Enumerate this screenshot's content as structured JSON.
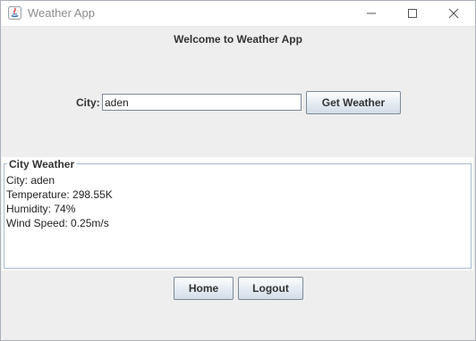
{
  "window": {
    "title": "Weather App",
    "icon": "java-icon",
    "controls": {
      "minimize_icon": "minimize-icon",
      "maximize_icon": "maximize-icon",
      "close_icon": "close-icon"
    }
  },
  "header": {
    "welcome": "Welcome to Weather App"
  },
  "search": {
    "city_label": "City:",
    "city_value": "aden",
    "get_weather_label": "Get Weather"
  },
  "panel": {
    "title": "City Weather",
    "lines": [
      "City: aden",
      "Temperature: 298.55K",
      "Humidity: 74%",
      "Wind Speed: 0.25m/s"
    ]
  },
  "footer": {
    "home_label": "Home",
    "logout_label": "Logout"
  },
  "colors": {
    "background": "#eeeeee",
    "panel_border": "#a9bcd0",
    "button_border": "#7a8a99"
  }
}
